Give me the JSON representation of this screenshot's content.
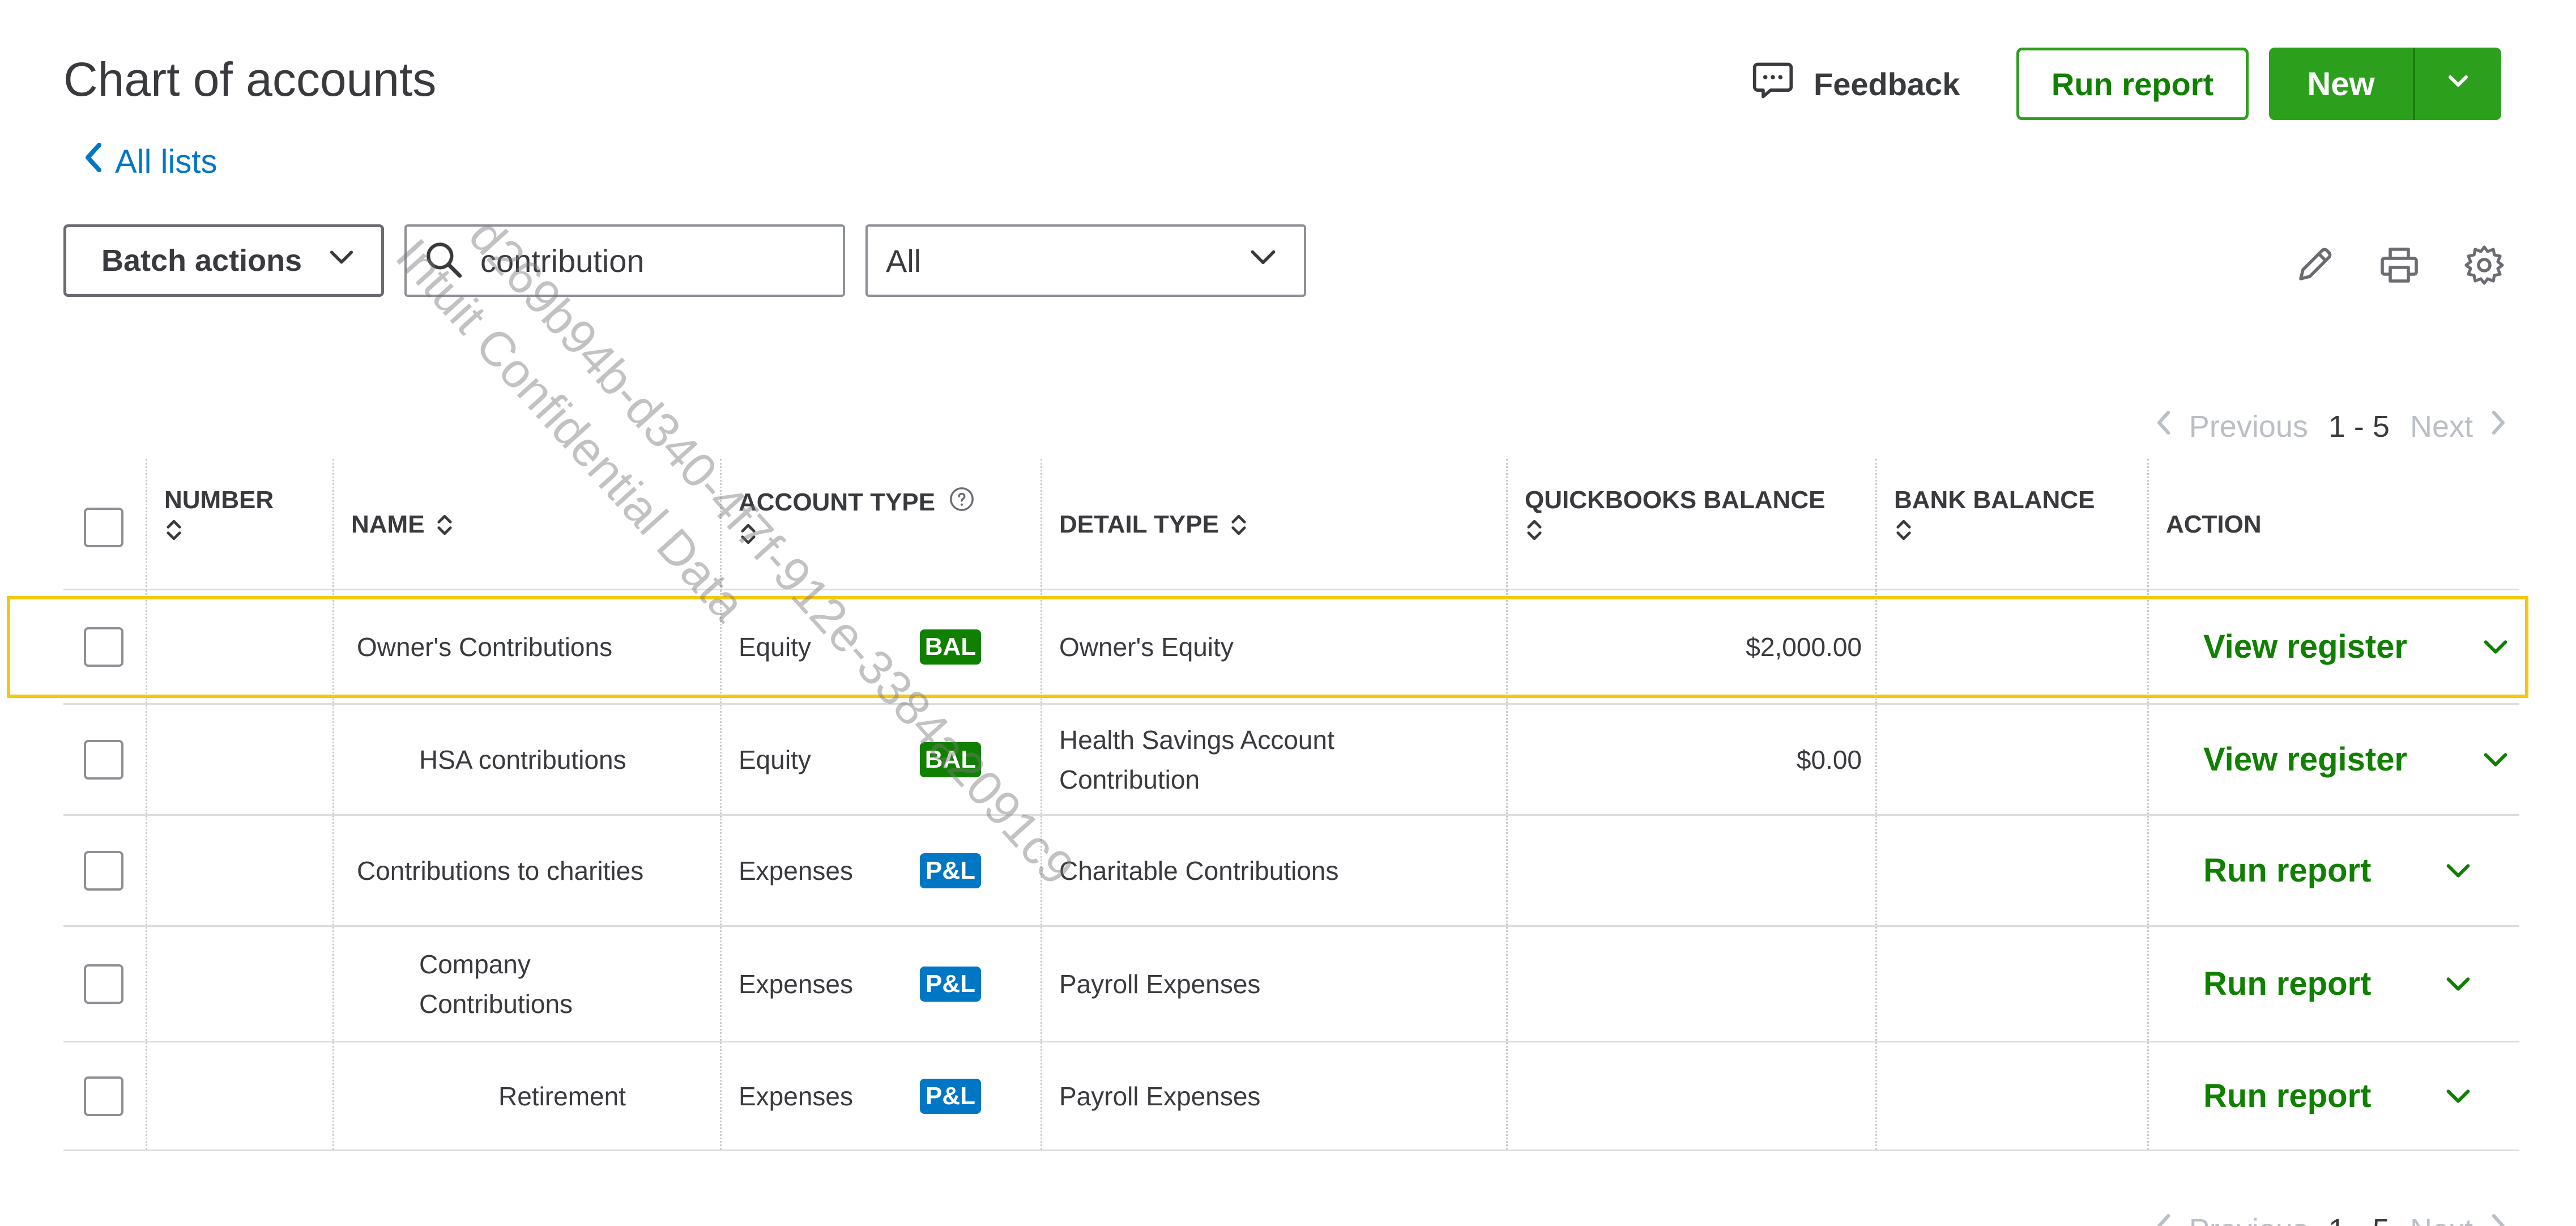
{
  "header": {
    "title": "Chart of accounts",
    "back_link": "All lists",
    "feedback": "Feedback",
    "run_report": "Run report",
    "new_label": "New"
  },
  "toolbar": {
    "batch_actions": "Batch actions",
    "search_value": "contribution",
    "filter_value": "All"
  },
  "pager": {
    "previous": "Previous",
    "range": "1 - 5",
    "next": "Next"
  },
  "columns": {
    "number": "NUMBER",
    "name": "NAME",
    "account_type": "ACCOUNT TYPE",
    "detail_type": "DETAIL TYPE",
    "qb_balance": "QUICKBOOKS BALANCE",
    "bank_balance": "BANK BALANCE",
    "action": "ACTION"
  },
  "rows": [
    {
      "number": "",
      "name_lines": [
        "Owner's Contributions"
      ],
      "account_type": "Equity",
      "badge": "BAL",
      "detail_lines": [
        "Owner's Equity"
      ],
      "qb_balance": "$2,000.00",
      "bank_balance": "",
      "action": "View register"
    },
    {
      "number": "",
      "name_lines": [
        "HSA contributions"
      ],
      "account_type": "Equity",
      "badge": "BAL",
      "detail_lines": [
        "Health Savings Account",
        "Contribution"
      ],
      "qb_balance": "$0.00",
      "bank_balance": "",
      "action": "View register"
    },
    {
      "number": "",
      "name_lines": [
        "Contributions to charities"
      ],
      "account_type": "Expenses",
      "badge": "P&L",
      "detail_lines": [
        "Charitable Contributions"
      ],
      "qb_balance": "",
      "bank_balance": "",
      "action": "Run report"
    },
    {
      "number": "",
      "name_lines": [
        "Company",
        "Contributions"
      ],
      "account_type": "Expenses",
      "badge": "P&L",
      "detail_lines": [
        "Payroll Expenses"
      ],
      "qb_balance": "",
      "bank_balance": "",
      "action": "Run report"
    },
    {
      "number": "",
      "name_lines": [
        "Retirement"
      ],
      "account_type": "Expenses",
      "badge": "P&L",
      "detail_lines": [
        "Payroll Expenses"
      ],
      "qb_balance": "",
      "bank_balance": "",
      "action": "Run report"
    }
  ],
  "watermark": {
    "line1": "d269b94b-d340-4f7f-912e-3384a2091c9",
    "line2": "Intuit Confidential Data"
  },
  "colors": {
    "primary_green": "#2ca01c",
    "text_green": "#108000",
    "link_blue": "#0077c5",
    "badge_bal": "#108000",
    "badge_pl": "#0077c5",
    "highlight": "#f2c811"
  },
  "icons": {
    "back": "chevron-left-icon",
    "feedback": "speech-bubble-icon",
    "search": "search-icon",
    "edit": "pencil-icon",
    "print": "printer-icon",
    "settings": "gear-icon",
    "sort": "sort-icon",
    "dropdown": "chevron-down-icon"
  }
}
